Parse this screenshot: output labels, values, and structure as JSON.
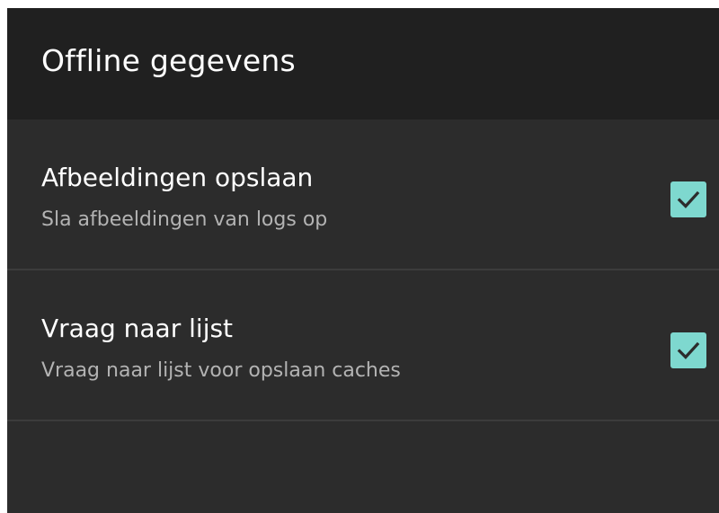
{
  "toolbar": {
    "title": "Offline gegevens"
  },
  "preferences": [
    {
      "title": "Afbeeldingen opslaan",
      "summary": "Sla afbeeldingen van logs op",
      "checked": true
    },
    {
      "title": "Vraag naar lijst",
      "summary": "Vraag naar lijst voor opslaan caches",
      "checked": true
    }
  ],
  "colors": {
    "toolbar_bg": "#202020",
    "screen_bg": "#2c2c2c",
    "checkbox_accent": "#7ed8cf",
    "check_mark": "#2c2c2c"
  },
  "icons": {
    "checkbox": "check-icon"
  }
}
